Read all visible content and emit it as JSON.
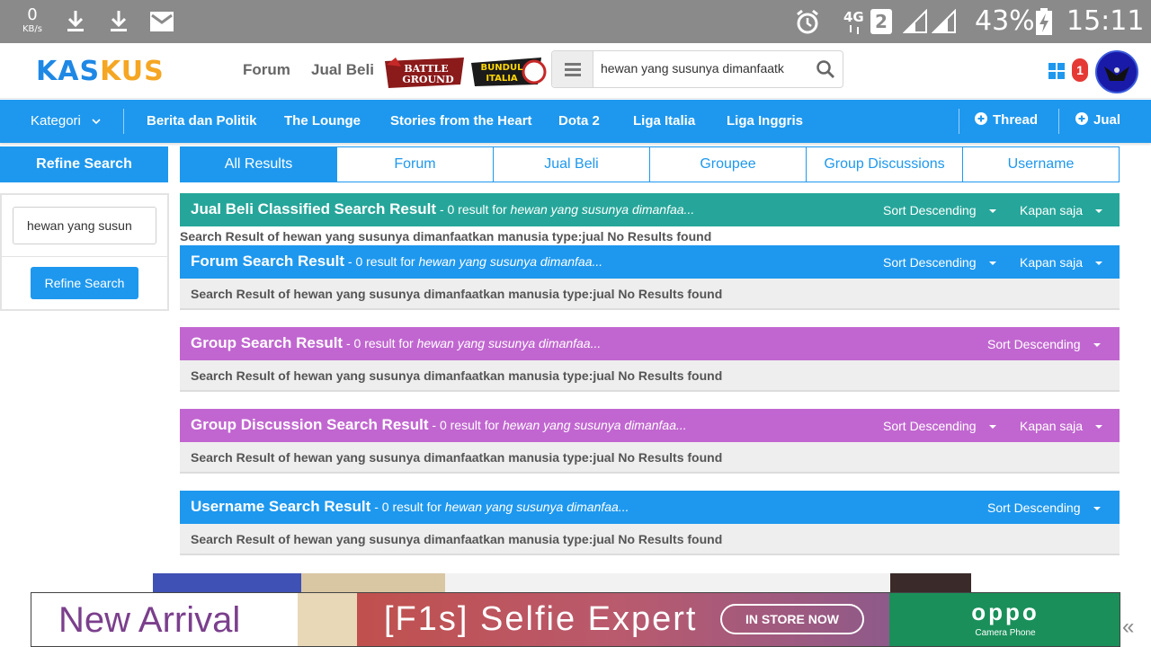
{
  "status_bar": {
    "speed_value": "0",
    "speed_unit": "KB/s",
    "network": "4G",
    "sim": "2",
    "battery": "43%",
    "time": "15:11"
  },
  "header": {
    "logo_part1": "KAS",
    "logo_part2": "KUS",
    "nav": [
      "Forum",
      "Jual Beli"
    ],
    "promo1": "BATTLE GROUND",
    "promo2": "BUNDUL ITALIA",
    "search_value": "hewan yang susunya dimanfaatk",
    "notification_count": "1"
  },
  "category_bar": {
    "kategori": "Kategori",
    "items": [
      "Berita dan Politik",
      "The Lounge",
      "Stories from the Heart",
      "Dota 2",
      "Liga Italia",
      "Liga Inggris"
    ],
    "thread": "Thread",
    "jual": "Jual"
  },
  "refine": {
    "heading": "Refine Search",
    "input_value": "hewan yang susun",
    "button": "Refine Search"
  },
  "tabs": [
    "All Results",
    "Forum",
    "Jual Beli",
    "Groupee",
    "Group Discussions",
    "Username"
  ],
  "results": {
    "jual_beli": {
      "title": "Jual Beli Classified Search Result",
      "count_text": " - 0 result for ",
      "query": "hewan yang susunya dimanfaa...",
      "sort": "Sort Descending",
      "time": "Kapan saja",
      "color": "#26a69a",
      "message": "Search Result of hewan yang susunya dimanfaatkan manusia type:jual No Results found"
    },
    "forum": {
      "title": "Forum Search Result",
      "count_text": " - 0 result for ",
      "query": "hewan yang susunya dimanfaa...",
      "sort": "Sort Descending",
      "time": "Kapan saja",
      "color": "#1e98ee",
      "message": "Search Result of hewan yang susunya dimanfaatkan manusia type:jual No Results found"
    },
    "group": {
      "title": "Group Search Result",
      "count_text": " - 0 result for ",
      "query": "hewan yang susunya dimanfaa...",
      "sort": "Sort Descending",
      "color": "#c166d0",
      "message": "Search Result of hewan yang susunya dimanfaatkan manusia type:jual No Results found"
    },
    "group_discussion": {
      "title": "Group Discussion Search Result",
      "count_text": " - 0 result for ",
      "query": "hewan yang susunya dimanfaa...",
      "sort": "Sort Descending",
      "time": "Kapan saja",
      "color": "#c166d0",
      "message": "Search Result of hewan yang susunya dimanfaatkan manusia type:jual No Results found"
    },
    "username": {
      "title": "Username Search Result",
      "count_text": " - 0 result for ",
      "query": "hewan yang susunya dimanfaa...",
      "sort": "Sort Descending",
      "color": "#1e98ee",
      "message": "Search Result of hewan yang susunya dimanfaatkan manusia type:jual No Results found"
    }
  },
  "ad": {
    "new_arrival": "New Arrival",
    "product": "[F1s] Selfie Expert",
    "cta": "IN STORE NOW",
    "brand": "oppo",
    "brand_sub": "Camera Phone",
    "collapse": "«"
  }
}
